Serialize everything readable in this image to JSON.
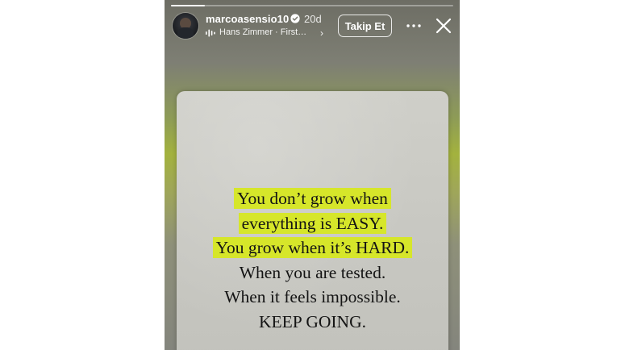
{
  "story": {
    "progress_fraction": 0.12,
    "username": "marcoasensio10",
    "time_ago": "20d",
    "music": "Hans Zimmer · First…",
    "follow_label": "Takip Et",
    "quote_lines": [
      {
        "text": "You don’t grow when",
        "highlight": true
      },
      {
        "text": "everything is EASY.",
        "highlight": true
      },
      {
        "text": "You grow when it’s HARD.",
        "highlight": true
      },
      {
        "text": "When you are tested.",
        "highlight": false
      },
      {
        "text": "When it feels impossible.",
        "highlight": false
      },
      {
        "text": "KEEP GOING.",
        "highlight": false
      }
    ],
    "colors": {
      "highlight": "#d6e62a",
      "verified_badge": "#ffffff"
    },
    "icons": [
      "verified-icon",
      "music-icon",
      "chevron-right-icon",
      "more-icon",
      "close-icon"
    ]
  }
}
